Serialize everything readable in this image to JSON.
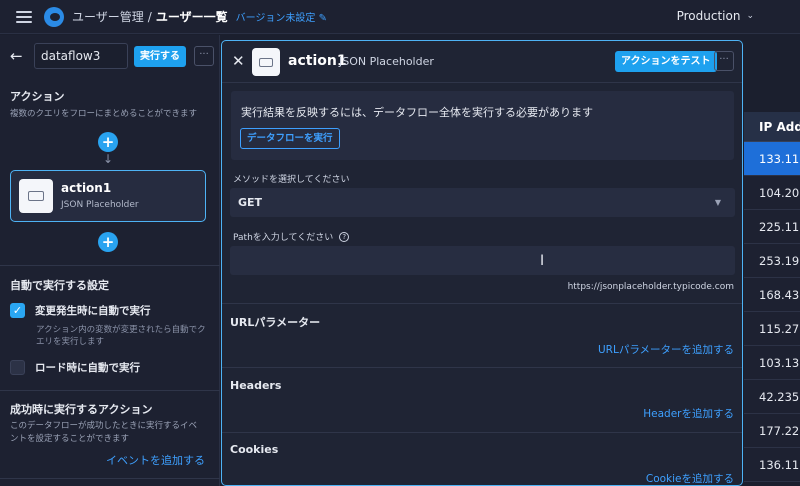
{
  "topbar": {
    "breadcrumb_parent": "ユーザー管理",
    "breadcrumb_sep": "/",
    "breadcrumb_current": "ユーザー一覧",
    "version_label": "バージョン未設定",
    "environment": "Production"
  },
  "left": {
    "flow_name": "dataflow3",
    "run_label": "実行する",
    "more_label": "···",
    "actions_title": "アクション",
    "actions_desc": "複数のクエリをフローにまとめることができます",
    "node": {
      "title": "action1",
      "subtitle": "JSON Placeholder"
    },
    "auto_title": "自動で実行する設定",
    "auto_on_change_label": "変更発生時に自動で実行",
    "auto_on_change_checked": true,
    "auto_on_change_desc": "アクション内の変数が変更されたら自動でクエリを実行します",
    "auto_on_load_label": "ロード時に自動で実行",
    "auto_on_load_checked": false,
    "success_title": "成功時に実行するアクション",
    "success_desc": "このデータフローが成功したときに実行するイベントを設定することができます",
    "add_event_label": "イベントを追加する"
  },
  "modal": {
    "title": "action1",
    "subtitle": "JSON Placeholder",
    "test_label": "アクションをテスト",
    "more_label": "···",
    "notice_text": "実行結果を反映するには、データフロー全体を実行する必要があります",
    "notice_button": "データフローを実行",
    "method_label": "メソッドを選択してください",
    "method_value": "GET",
    "path_label": "Pathを入力してください",
    "path_value": "",
    "host": "https://jsonplaceholder.typicode.com",
    "url_params_title": "URLパラメーター",
    "url_params_add": "URLパラメーターを追加する",
    "headers_title": "Headers",
    "headers_add": "Headerを追加する",
    "cookies_title": "Cookies",
    "cookies_add": "Cookieを追加する"
  },
  "table": {
    "header": "IP Add",
    "rows": [
      "133.11",
      "104.20",
      "225.11",
      "253.19",
      "168.43",
      "115.27",
      "103.13",
      "42.235",
      "177.22",
      "136.11"
    ],
    "selected_row": 0
  },
  "colors": {
    "accent": "#1ea1ef",
    "link": "#3ea0ff",
    "selected_row": "#1e6fd9",
    "background": "#1b1f2e"
  }
}
